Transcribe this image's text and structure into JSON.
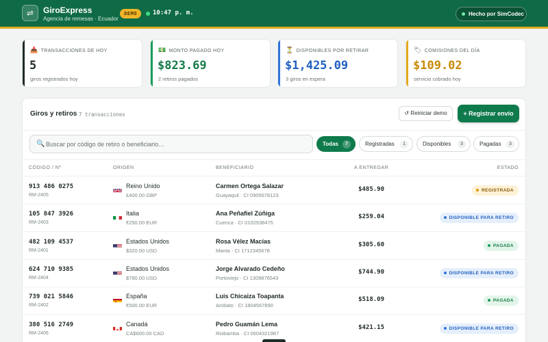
{
  "header": {
    "logo_glyph": "⇌",
    "title": "GiroExpress",
    "subtitle": "Agencia de remesas · Ecuador",
    "demo_badge": "DEMO",
    "clock": "10:47 p. m.",
    "made_by": "Hecho por SimCodec",
    "colors": {
      "bar": "#0f6b45",
      "stripe": "#e0ad1f"
    }
  },
  "stats": [
    {
      "icon": "📥",
      "icon_name": "inbox-tray-icon",
      "label": "TRANSACCIONES DE HOY",
      "value": "5",
      "sub": "giros registrados hoy",
      "color": "#1f2a27",
      "accent": "#1f2a27"
    },
    {
      "icon": "💵",
      "icon_name": "banknote-icon",
      "label": "MONTO PAGADO HOY",
      "value": "$823.69",
      "sub": "2 retiros pagados",
      "color": "#137a47",
      "accent": "#1a9a5a"
    },
    {
      "icon": "⏳",
      "icon_name": "hourglass-icon",
      "label": "DISPONIBLES POR RETIRAR",
      "value": "$1,425.09",
      "sub": "3 giros en espera",
      "color": "#1f5fbf",
      "accent": "#2f74d9"
    },
    {
      "icon": "🏷",
      "icon_name": "tag-icon",
      "label": "COMISIONES DEL DÍA",
      "value": "$109.02",
      "sub": "servicio cobrado hoy",
      "color": "#c98a08",
      "accent": "#e6a817"
    }
  ],
  "panel": {
    "title": "Giros y retiros",
    "count": "7 transacciones",
    "reset_label": "↺ Reiniciar demo",
    "register_label": "+ Registrar envío",
    "search_icon": "🔍",
    "search_placeholder": "Buscar por código de retiro o beneficiario…",
    "search_value": "",
    "filters": [
      {
        "label": "Todas",
        "count": "7",
        "active": true
      },
      {
        "label": "Registradas",
        "count": "1",
        "active": false
      },
      {
        "label": "Disponibles",
        "count": "3",
        "active": false
      },
      {
        "label": "Pagadas",
        "count": "3",
        "active": false
      }
    ],
    "columns": [
      "CÓDIGO / Nº",
      "ORIGEN",
      "BENEFICIARIO",
      "A ENTREGAR",
      "ESTADO"
    ]
  },
  "rows": [
    {
      "code": "913 486 0275",
      "ref": "RM-2405",
      "flag": "uk",
      "country": "Reino Unido",
      "amount_orig": "£400.00 GBP",
      "name": "Carmen Ortega Salazar",
      "loc": "Guayaquil · CI 0905678123",
      "deliver": "$485.90",
      "status": "REGISTRADA",
      "status_kind": "registrada"
    },
    {
      "code": "105 847 3926",
      "ref": "RM-2403",
      "flag": "it",
      "country": "Italia",
      "amount_orig": "€250.00 EUR",
      "name": "Ana Peñafiel Zúñiga",
      "loc": "Cuenca · CI 0102938475",
      "deliver": "$259.04",
      "status": "DISPONIBLE PARA RETIRO",
      "status_kind": "disponible"
    },
    {
      "code": "482 109 4537",
      "ref": "RM-2401",
      "flag": "us",
      "country": "Estados Unidos",
      "amount_orig": "$320.00 USD",
      "name": "Rosa Vélez Macías",
      "loc": "Manta · CI 1712345678",
      "deliver": "$305.60",
      "status": "PAGADA",
      "status_kind": "pagada"
    },
    {
      "code": "624 710 9385",
      "ref": "RM-2404",
      "flag": "us",
      "country": "Estados Unidos",
      "amount_orig": "$780.00 USD",
      "name": "Jorge Alvarado Cedeño",
      "loc": "Portoviejo · CI 1309876543",
      "deliver": "$744.90",
      "status": "DISPONIBLE PARA RETIRO",
      "status_kind": "disponible"
    },
    {
      "code": "739 021 5846",
      "ref": "RM-2402",
      "flag": "es",
      "country": "España",
      "amount_orig": "€500.00 EUR",
      "name": "Luis Chicaiza Toapanta",
      "loc": "Ambato · CI 1804567890",
      "deliver": "$518.09",
      "status": "PAGADA",
      "status_kind": "pagada"
    },
    {
      "code": "380 516 2749",
      "ref": "RM-2406",
      "flag": "ca",
      "country": "Canadá",
      "amount_orig": "CA$600.00 CAD",
      "name": "Pedro Guamán Lema",
      "loc": "Riobamba · CI 0604321987",
      "deliver": "$421.15",
      "status": "DISPONIBLE PARA RETIRO",
      "status_kind": "disponible"
    }
  ]
}
